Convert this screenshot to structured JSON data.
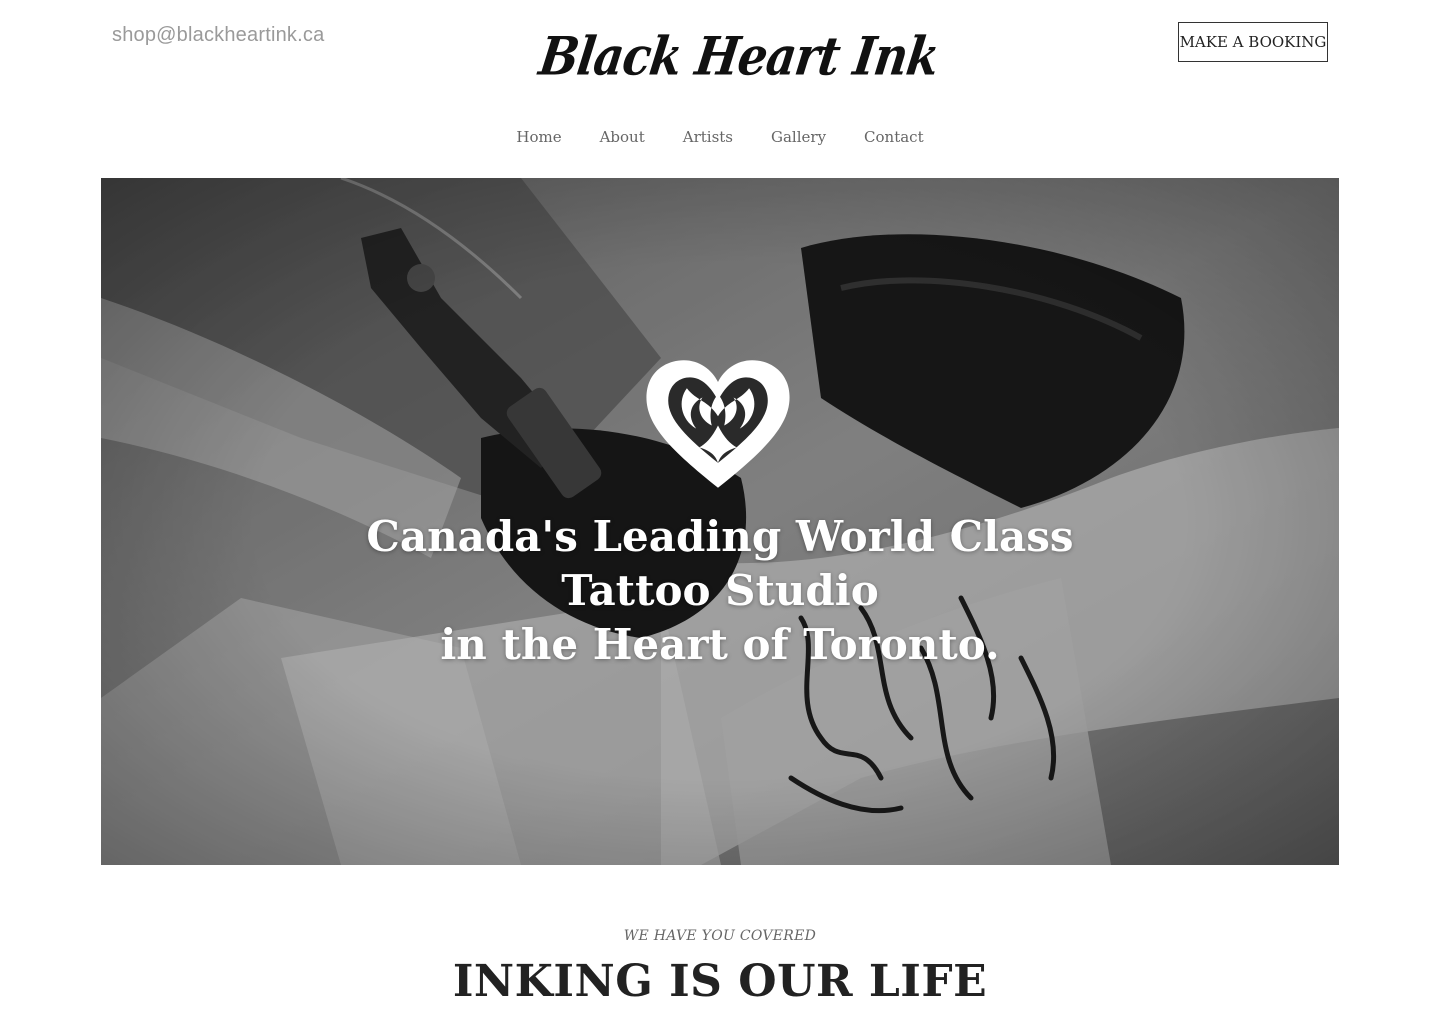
{
  "header": {
    "email": "shop@blackheartink.ca",
    "logo_text": "Black Heart Ink",
    "booking_label": "MAKE A BOOKING"
  },
  "nav": {
    "items": [
      {
        "label": "Home"
      },
      {
        "label": "About"
      },
      {
        "label": "Artists"
      },
      {
        "label": "Gallery"
      },
      {
        "label": "Contact"
      }
    ]
  },
  "hero": {
    "title_lines": [
      "Canada's Leading World Class",
      "Tattoo Studio",
      "in the Heart of Toronto."
    ]
  },
  "section": {
    "eyebrow": "WE HAVE YOU COVERED",
    "title": "INKING IS OUR LIFE"
  },
  "colors": {
    "text_dark": "#222222",
    "muted": "#9a9a9a",
    "hero_text": "#ffffff"
  }
}
